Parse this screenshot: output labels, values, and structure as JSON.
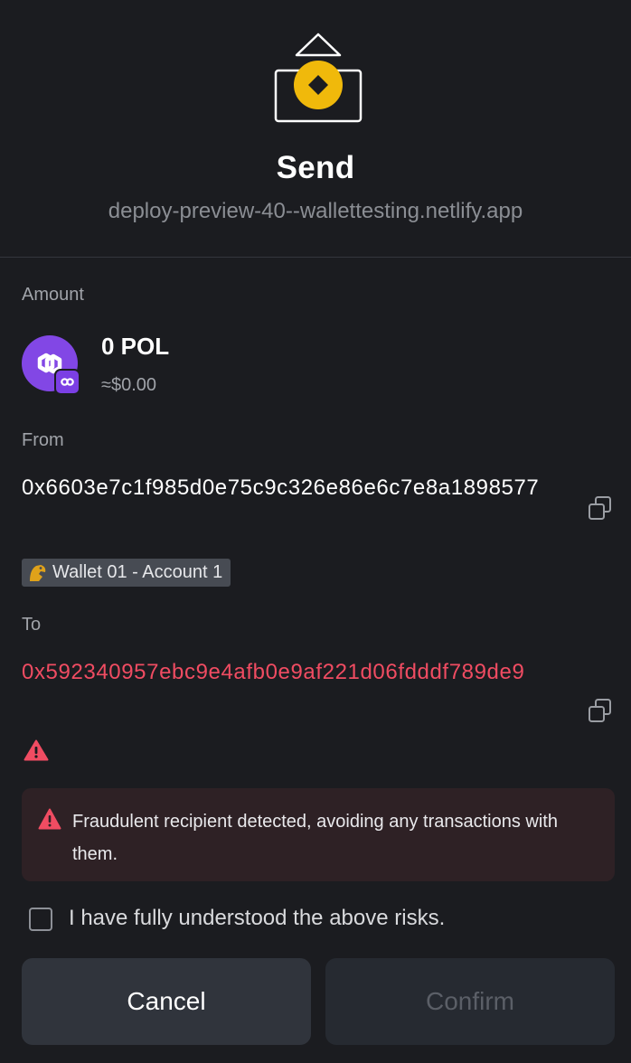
{
  "header": {
    "title": "Send",
    "origin": "deploy-preview-40--wallettesting.netlify.app",
    "logo_icon": "send-coin-icon"
  },
  "amount": {
    "label": "Amount",
    "value": "0 POL",
    "fiat": "≈$0.00",
    "token_icon": "polygon-token-icon",
    "colors": {
      "token": "#8247e5"
    }
  },
  "from": {
    "label": "From",
    "address": "0x6603e7c1f985d0e75c9c326e86e6c7e8a1898577",
    "wallet_badge": "Wallet 01 - Account 1",
    "badge_icon": "wallet-avatar-icon"
  },
  "to": {
    "label": "To",
    "address": "0x592340957ebc9e4afb0e9af221d06fdddf789de9",
    "color": "#f04c62"
  },
  "alert": {
    "icon": "warning-triangle-icon",
    "message": "Fraudulent recipient detected, avoiding any transactions with them."
  },
  "risk_ack": {
    "label": "I have fully understood the above risks.",
    "checked": false
  },
  "actions": {
    "cancel_label": "Cancel",
    "confirm_label": "Confirm",
    "confirm_enabled": false
  },
  "colors": {
    "background": "#1b1c20",
    "accent": "#f0b90b",
    "danger": "#f04c62"
  }
}
